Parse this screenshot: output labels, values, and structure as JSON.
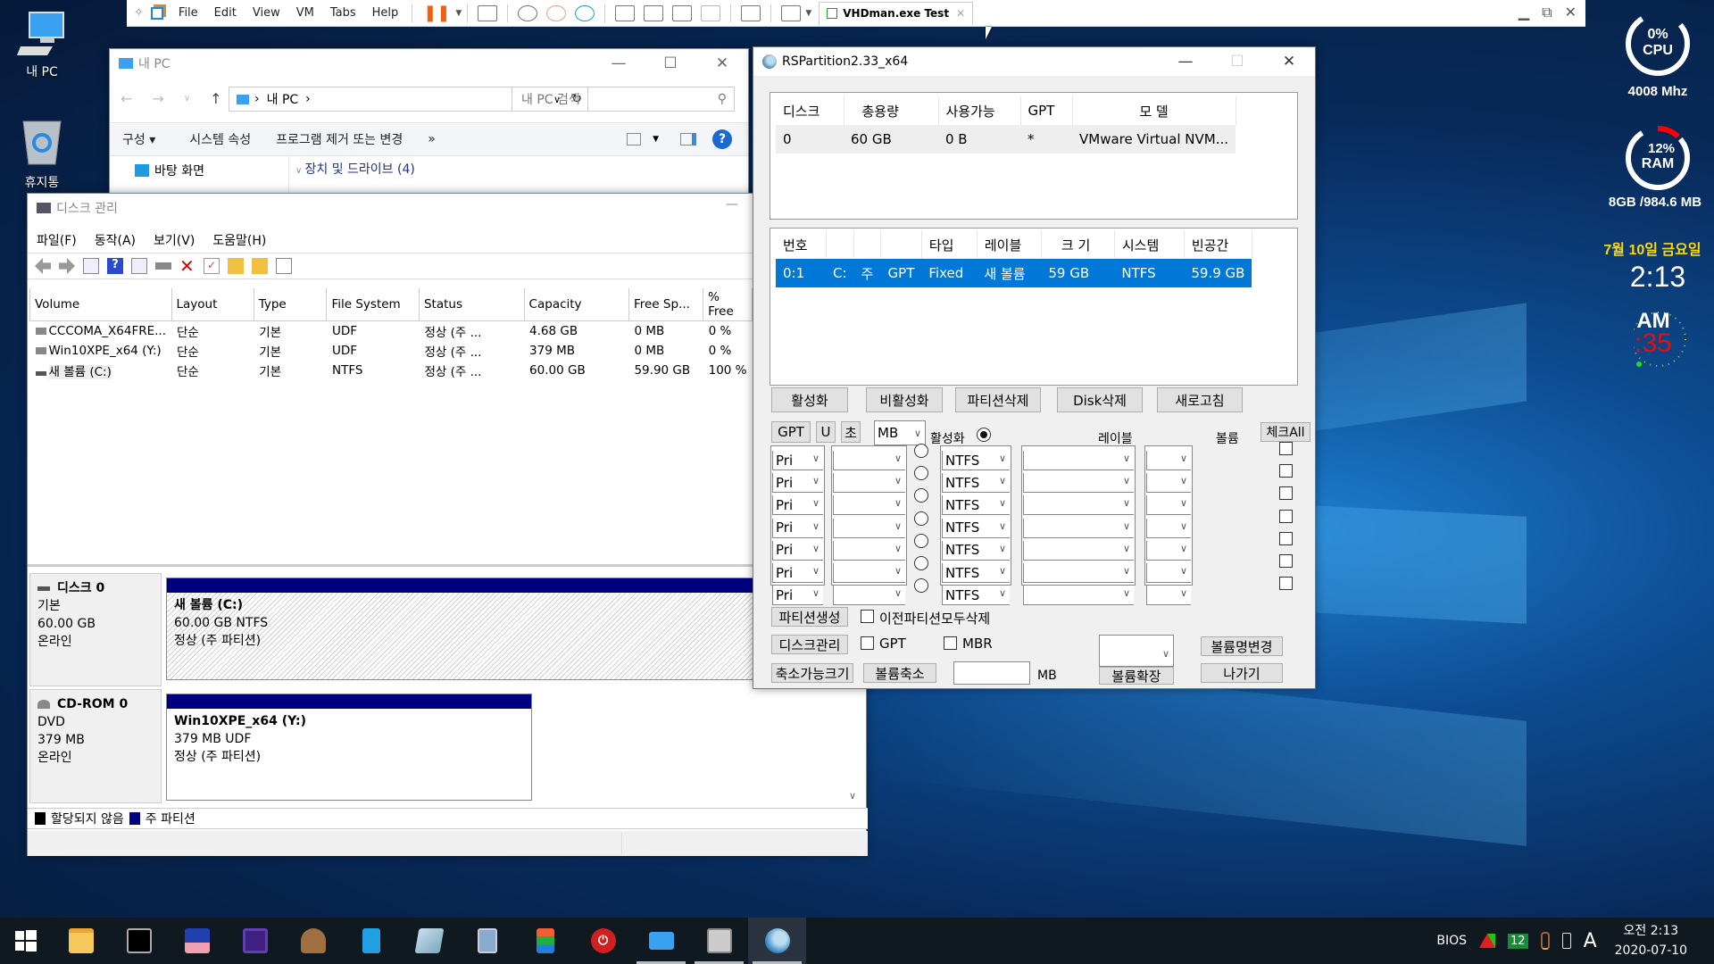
{
  "desktop": {
    "icons": [
      {
        "label": "내 PC",
        "icon": "computer-icon"
      },
      {
        "label": "휴지통",
        "icon": "recycle-bin-icon"
      }
    ]
  },
  "vmware": {
    "menu": [
      "File",
      "Edit",
      "View",
      "VM",
      "Tabs",
      "Help"
    ],
    "tab_label": "VHDman.exe Test",
    "tab_close": "✕"
  },
  "explorer": {
    "title": "내 PC",
    "address_path": [
      "내 PC"
    ],
    "search_placeholder": "내 PC 검색",
    "commands": [
      "구성 ▾",
      "시스템 속성",
      "프로그램 제거 또는 변경",
      "»"
    ],
    "nav_item": "바탕 화면",
    "group_header": "장치 및 드라이브 (4)"
  },
  "disk_mgmt": {
    "title": "디스크 관리",
    "menu": [
      "파일(F)",
      "동작(A)",
      "보기(V)",
      "도움말(H)"
    ],
    "columns": [
      "Volume",
      "Layout",
      "Type",
      "File System",
      "Status",
      "Capacity",
      "Free Sp...",
      "% Free"
    ],
    "rows": [
      [
        "CCCOMA_X64FRE...",
        "단순",
        "기본",
        "UDF",
        "정상 (주 ...",
        "4.68 GB",
        "0 MB",
        "0 %"
      ],
      [
        "Win10XPE_x64 (Y:)",
        "단순",
        "기본",
        "UDF",
        "정상 (주 ...",
        "379 MB",
        "0 MB",
        "0 %"
      ],
      [
        "새 볼륨 (C:)",
        "단순",
        "기본",
        "NTFS",
        "정상 (주 ...",
        "60.00 GB",
        "59.90 GB",
        "100 %"
      ]
    ],
    "disks": [
      {
        "name": "디스크 0",
        "type": "기본",
        "size": "60.00 GB",
        "status": "온라인",
        "partition": {
          "name": "새 볼륨  (C:)",
          "detail": "60.00 GB NTFS",
          "status": "정상 (주 파티션)"
        }
      },
      {
        "name": "CD-ROM 0",
        "type": "DVD",
        "size": "379 MB",
        "status": "온라인",
        "partition": {
          "name": "Win10XPE_x64  (Y:)",
          "detail": "379 MB UDF",
          "status": "정상 (주 파티션)"
        }
      }
    ],
    "legend": [
      {
        "label": "할당되지 않음",
        "color": "#000000"
      },
      {
        "label": "주 파티션",
        "color": "#000080"
      }
    ]
  },
  "rspartition": {
    "title": "RSPartition2.33_x64",
    "disk_columns": [
      "디스크",
      "총용량",
      "사용가능",
      "GPT",
      "모  델"
    ],
    "disk_rows": [
      [
        "0",
        "60 GB",
        "0 B",
        "*",
        "VMware Virtual NVM..."
      ]
    ],
    "part_columns": [
      "번호",
      "",
      "",
      "",
      "타입",
      "레이블",
      "크 기",
      "시스템",
      "빈공간"
    ],
    "part_rows": [
      [
        "0:1",
        "C:",
        "주",
        "GPT",
        "Fixed",
        "새 볼륨",
        "59 GB",
        "NTFS",
        "59.9 GB"
      ]
    ],
    "action_buttons": [
      "활성화",
      "비활성화",
      "파티션삭제",
      "Disk삭제",
      "새로고침"
    ],
    "mini_buttons": [
      "GPT",
      "U",
      "초"
    ],
    "unit_select": "MB",
    "active_label": "활성화",
    "label_header": "레이블",
    "volume_header": "볼륨",
    "check_all": "체크All",
    "create_rows": [
      {
        "type": "Pri",
        "size": "",
        "fs": "NTFS",
        "label": "",
        "vol": ""
      },
      {
        "type": "Pri",
        "size": "",
        "fs": "NTFS",
        "label": "",
        "vol": ""
      },
      {
        "type": "Pri",
        "size": "",
        "fs": "NTFS",
        "label": "",
        "vol": ""
      },
      {
        "type": "Pri",
        "size": "",
        "fs": "NTFS",
        "label": "",
        "vol": ""
      },
      {
        "type": "Pri",
        "size": "",
        "fs": "NTFS",
        "label": "",
        "vol": ""
      },
      {
        "type": "Pri",
        "size": "",
        "fs": "NTFS",
        "label": "",
        "vol": ""
      },
      {
        "type": "Pri",
        "size": "",
        "fs": "NTFS",
        "label": "",
        "vol": ""
      }
    ],
    "create_button": "파티션생성",
    "delete_prev_label": "이전파티션모두삭제",
    "diskmgmt_button": "디스크관리",
    "gpt_label": "GPT",
    "mbr_label": "MBR",
    "rename_button": "볼륨명변경",
    "shrinkable_button": "축소가능크기",
    "shrink_button": "볼륨축소",
    "shrink_unit": "MB",
    "extend_button": "볼륨확장",
    "exit_button": "나가기"
  },
  "widgets": {
    "cpu_percent": 0,
    "cpu_label": "0%",
    "cpu_name": "CPU",
    "cpu_freq": "4008 Mhz",
    "ram_percent": 12,
    "ram_label": "12%",
    "ram_name": "RAM",
    "ram_info": "8GB /984.6 MB",
    "date": "7월 10일 금요일",
    "time": "2:13",
    "ampm": "AM",
    "seconds": ":35",
    "colors": {
      "date": "#ffd800",
      "seconds": "#e01010",
      "ram_used": "#ff0000"
    }
  },
  "taskbar": {
    "apps": [
      "start",
      "file-explorer",
      "command-prompt",
      "save-disk",
      "cpu-tool",
      "installer",
      "network-tool",
      "notepad",
      "calculator",
      "partition-tool",
      "power",
      "this-pc",
      "disk-tool",
      "rspartition"
    ],
    "tray": {
      "bios": "BIOS",
      "badge": "12",
      "ime": "A",
      "time": "오전 2:13",
      "date": "2020-07-10"
    }
  }
}
